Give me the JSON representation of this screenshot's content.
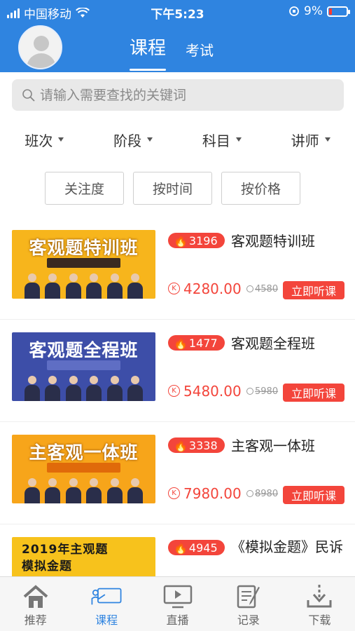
{
  "status_bar": {
    "carrier": "中国移动",
    "time": "下午5:23",
    "battery": "9%"
  },
  "header": {
    "tabs": [
      {
        "label": "课程",
        "active": true
      },
      {
        "label": "考试",
        "active": false
      }
    ]
  },
  "search": {
    "placeholder": "请输入需要查找的关键词"
  },
  "filters": [
    "班次",
    "阶段",
    "科目",
    "讲师"
  ],
  "sort_buttons": [
    "关注度",
    "按时间",
    "按价格"
  ],
  "courses": [
    {
      "banner": "客观题特训班",
      "hot": "3196",
      "title": "客观题特训班",
      "price": "4280.00",
      "original_price": "4580",
      "buy": "立即听课",
      "bg": "#f7b51c"
    },
    {
      "banner": "客观题全程班",
      "hot": "1477",
      "title": "客观题全程班",
      "price": "5480.00",
      "original_price": "5980",
      "buy": "立即听课",
      "bg": "#3d4ea8"
    },
    {
      "banner": "主客观一体班",
      "hot": "3338",
      "title": "主客观一体班",
      "price": "7980.00",
      "original_price": "8980",
      "buy": "立即听课",
      "bg": "#f7a51a"
    },
    {
      "banner": "2019年主观题 模拟金题",
      "hot": "4945",
      "title": "《模拟金题》民诉",
      "price": "",
      "original_price": "",
      "buy": "",
      "bg": "#f7c21c"
    }
  ],
  "tabbar": [
    {
      "label": "推荐",
      "icon": "home-icon",
      "active": false
    },
    {
      "label": "课程",
      "icon": "course-icon",
      "active": true
    },
    {
      "label": "直播",
      "icon": "live-icon",
      "active": false
    },
    {
      "label": "记录",
      "icon": "record-icon",
      "active": false
    },
    {
      "label": "下载",
      "icon": "download-icon",
      "active": false
    }
  ],
  "colors": {
    "primary": "#2f84e0",
    "accent": "#f3453b"
  }
}
